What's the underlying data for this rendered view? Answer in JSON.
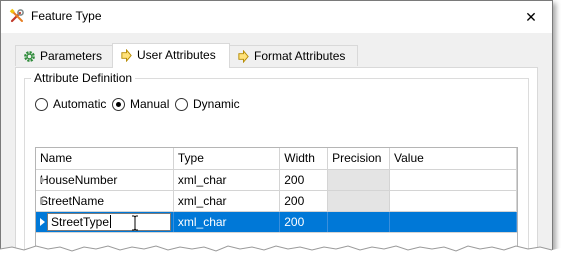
{
  "window": {
    "title": "Feature Type",
    "close_glyph": "✕",
    "icon": "wrench-tools-icon"
  },
  "tabs": [
    {
      "label": "Parameters",
      "icon": "gear-icon",
      "active": false
    },
    {
      "label": "User Attributes",
      "icon": "arrow-right-icon",
      "active": true
    },
    {
      "label": "Format Attributes",
      "icon": "arrow-right-icon",
      "active": false
    }
  ],
  "attribute_definition": {
    "legend": "Attribute Definition",
    "options": [
      {
        "label": "Automatic",
        "selected": false
      },
      {
        "label": "Manual",
        "selected": true
      },
      {
        "label": "Dynamic",
        "selected": false
      }
    ]
  },
  "table": {
    "columns": [
      "Name",
      "Type",
      "Width",
      "Precision",
      "Value"
    ],
    "rows": [
      {
        "name": "HouseNumber",
        "type": "xml_char",
        "width": "200",
        "precision": "",
        "value": "",
        "selected": false
      },
      {
        "name": "StreetName",
        "type": "xml_char",
        "width": "200",
        "precision": "",
        "value": "",
        "selected": false
      },
      {
        "name": "StreetType",
        "type": "xml_char",
        "width": "200",
        "precision": "",
        "value": "",
        "selected": true,
        "editing": true
      }
    ]
  },
  "colors": {
    "selection": "#0078d7",
    "panel_background": "#f0f0f0",
    "readonly_cell": "#e4e4e4"
  }
}
